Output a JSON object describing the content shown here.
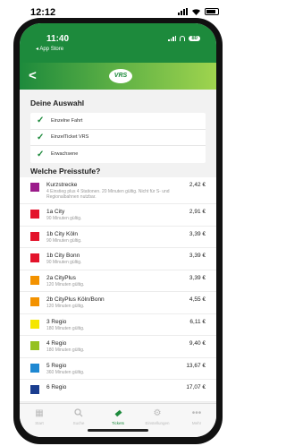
{
  "device": {
    "time": "12:12"
  },
  "app_status": {
    "time": "11:40",
    "back_app": "◂ App Store",
    "battery": "80"
  },
  "nav": {
    "back": "<",
    "logo": "VRS"
  },
  "selection": {
    "title": "Deine Auswahl",
    "items": [
      "Einzelne Fahrt",
      "EinzelTicket VRS",
      "Erwachsene"
    ]
  },
  "prices": {
    "title": "Welche Preisstufe?",
    "rows": [
      {
        "name": "Kurzstrecke",
        "desc": "4 Einstieg plus 4 Stationen. 20 Minuten gültig. Nicht für S- und Regionalbahnen nutzbar.",
        "price": "2,42 €",
        "color": "#9b1b8a"
      },
      {
        "name": "1a City",
        "desc": "90 Minuten gültig.",
        "price": "2,91 €",
        "color": "#e3132b"
      },
      {
        "name": "1b City Köln",
        "desc": "90 Minuten gültig.",
        "price": "3,39 €",
        "color": "#e3132b"
      },
      {
        "name": "1b City Bonn",
        "desc": "90 Minuten gültig.",
        "price": "3,39 €",
        "color": "#e3132b"
      },
      {
        "name": "2a CityPlus",
        "desc": "120 Minuten gültig.",
        "price": "3,39 €",
        "color": "#f39200"
      },
      {
        "name": "2b CityPlus Köln/Bonn",
        "desc": "120 Minuten gültig.",
        "price": "4,55 €",
        "color": "#f39200"
      },
      {
        "name": "3 Regio",
        "desc": "180 Minuten gültig.",
        "price": "6,11 €",
        "color": "#f5e600"
      },
      {
        "name": "4 Regio",
        "desc": "180 Minuten gültig.",
        "price": "9,40 €",
        "color": "#95c11f"
      },
      {
        "name": "5 Regio",
        "desc": "360 Minuten gültig.",
        "price": "13,67 €",
        "color": "#1e88d2"
      },
      {
        "name": "6 Regio",
        "desc": "",
        "price": "17,07 €",
        "color": "#1a3d8f"
      }
    ]
  },
  "tabs": [
    {
      "label": "Start",
      "icon": "grid-icon"
    },
    {
      "label": "Suche",
      "icon": "search-icon"
    },
    {
      "label": "Tickets",
      "icon": "ticket-icon"
    },
    {
      "label": "Einstellungen",
      "icon": "gear-icon"
    },
    {
      "label": "Mehr",
      "icon": "more-icon"
    }
  ]
}
